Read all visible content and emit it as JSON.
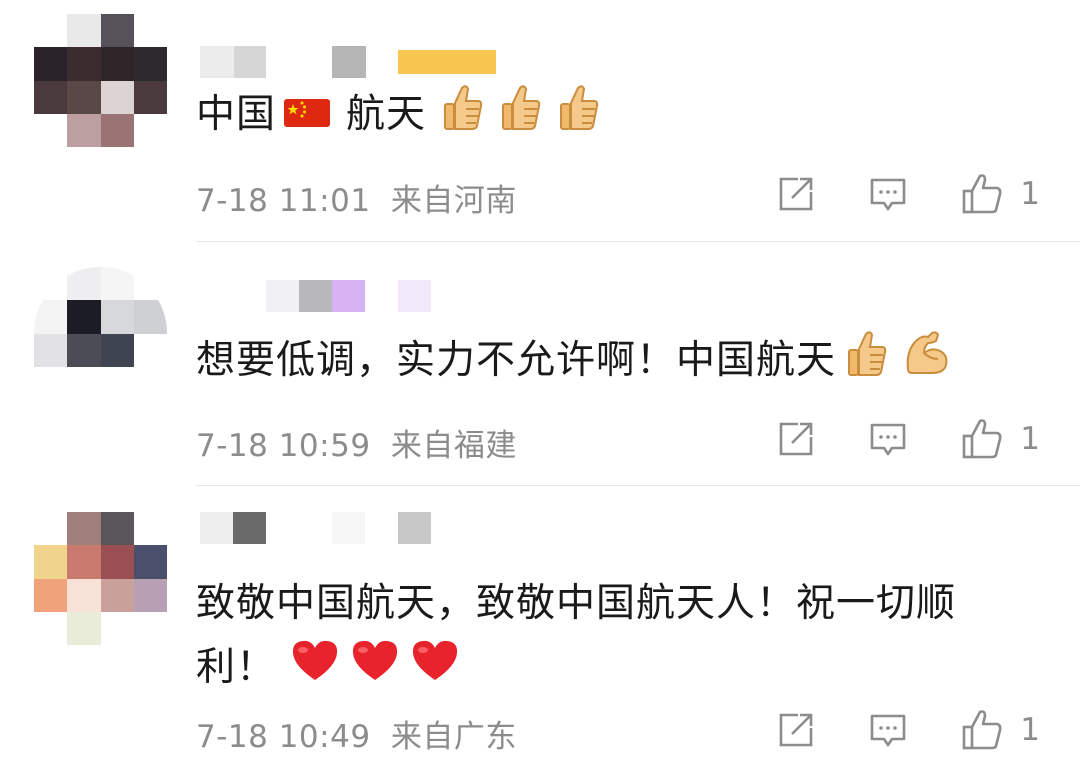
{
  "comments": [
    {
      "content": "中国 航天",
      "content_emojis": [
        "china-flag",
        "thumbs-up",
        "thumbs-up",
        "thumbs-up"
      ],
      "time": "7-18 11:01",
      "location": "来自河南",
      "like_count": "1"
    },
    {
      "content": "想要低调，实力不允许啊！中国航天",
      "content_emojis": [
        "thumbs-up",
        "flexed-biceps"
      ],
      "time": "7-18 10:59",
      "location": "来自福建",
      "like_count": "1"
    },
    {
      "content_line1": "致敬中国航天，致敬中国航天人！祝一切顺",
      "content_line2": "利！",
      "content_emojis": [
        "red-heart",
        "red-heart",
        "red-heart"
      ],
      "time": "7-18 10:49",
      "location": "来自广东",
      "like_count": "1"
    }
  ],
  "icons": {
    "repost": "repost-icon",
    "comment": "comment-icon",
    "like": "thumbs-up-icon"
  },
  "colors": {
    "text": "#1a1a1a",
    "meta": "#8c8c8c",
    "heart": "#e8232b",
    "thumb": "#f2c27a"
  }
}
